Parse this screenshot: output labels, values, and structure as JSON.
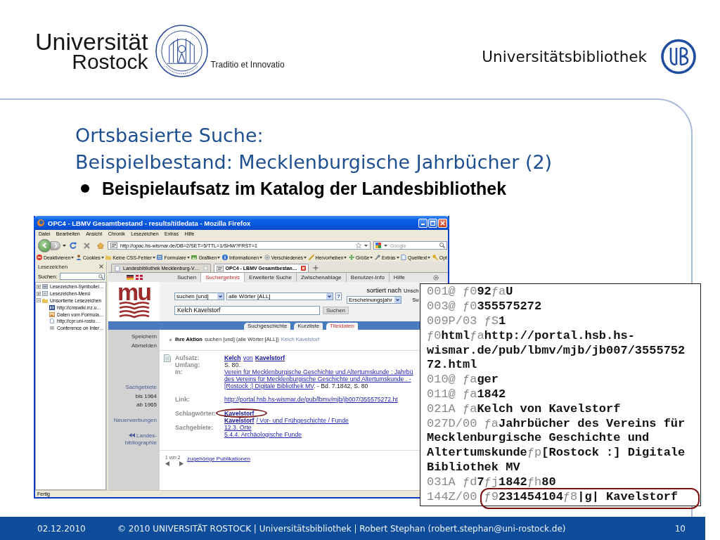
{
  "header": {
    "university": "Universität",
    "city": "Rostock",
    "motto": "Traditio et Innovatio",
    "library": "Universitätsbibliothek"
  },
  "slide": {
    "title_lines": [
      "Ortsbasierte Suche:",
      "Beispielbestand: Mecklenburgische Jahrbücher (2)"
    ],
    "bullet": "Beispielaufsatz im Katalog der Landesbibliothek"
  },
  "browser": {
    "title": "OPC4 - LBMV Gesamtbestand - results/titledata - Mozilla Firefox",
    "menu": [
      "Datei",
      "Bearbeiten",
      "Ansicht",
      "Chronik",
      "Lesezeichen",
      "Extras",
      "Hilfe"
    ],
    "address": "http://opac.hs-wismar.de/DB=2/SET=5/TTL=1/SHW?FRST=1",
    "search": {
      "placeholder": "Google"
    },
    "toolbar": [
      "Deaktivieren",
      "Cookies",
      "Keine CSS-Fehler",
      "Formulare",
      "Grafiken",
      "Informationen",
      "Verschiedenes",
      "Hervorheben",
      "Größe",
      "Extras",
      "Quelltext",
      "Opt"
    ],
    "sidebar": {
      "title": "Lesezeichen",
      "search_label": "Suchen:",
      "tree": [
        {
          "label": "Lesezeichen-Symbollei…",
          "expanded": false
        },
        {
          "label": "Lesezeichen-Menü",
          "expanded": false
        },
        {
          "label": "Unsortierte Lesezeichen",
          "expanded": true,
          "children": [
            {
              "label": "http://cmswiki.rrz.u…"
            },
            {
              "label": "Daten vom Formula…"
            },
            {
              "label": "http://cpr.uni-rosto…"
            },
            {
              "label": "Conference on Inter…"
            }
          ]
        }
      ]
    },
    "tabs": [
      {
        "label": "Landesbibliothek Mecklenburg-V…",
        "selected": false
      },
      {
        "label": "OPC4 - LBMV Gesamtbestan…",
        "selected": true
      }
    ],
    "status": "Fertig"
  },
  "opac": {
    "nav": [
      {
        "label": "Suchen",
        "selected": false
      },
      {
        "label": "Suchergebnis",
        "selected": true
      },
      {
        "label": "Erweiterte Suche",
        "selected": false
      },
      {
        "label": "Zwischenablage",
        "selected": false
      },
      {
        "label": "Benutzer-Info",
        "selected": false
      },
      {
        "label": "Hilfe",
        "selected": false
      }
    ],
    "logo_text": "mu",
    "form": {
      "mode": "suchen [und]",
      "field": "alle Wörter [ALL]",
      "help": "?",
      "sort_label": "sortiert nach",
      "sort": "Erscheinungsjahr",
      "partial_labels": [
        "Unsch",
        "Su"
      ],
      "query": "Kelch Kavelstorf",
      "submit": "Suchen"
    },
    "view_tabs": [
      {
        "label": "Suchgeschichte",
        "selected": false
      },
      {
        "label": "Kurzliste",
        "selected": false
      },
      {
        "label": "Titeldaten",
        "selected": true
      }
    ],
    "side_groups": [
      [
        {
          "label": "Speichern",
          "kind": "command"
        },
        {
          "label": "Abmelden",
          "kind": "command"
        }
      ],
      [
        {
          "label": "Sachgebiete",
          "kind": "link"
        },
        {
          "label": "bis 1964",
          "kind": "text"
        },
        {
          "label": "ab 1965",
          "kind": "text"
        }
      ],
      [
        {
          "label": "Neuerwerbungen",
          "kind": "link"
        }
      ],
      [
        {
          "label": "Landes-bibliographie",
          "kind": "back_link"
        }
      ]
    ],
    "action": {
      "label": "Ihre Aktion",
      "text": "suchen [und] (alle Wörter [ALL])",
      "query": "Kelch Kavelstorf"
    },
    "record_groups": [
      [
        {
          "label": "Aufsatz:",
          "lines": [
            [
              {
                "text": "Kelch",
                "kind": "strong_link"
              },
              {
                "text": "von",
                "kind": "link"
              },
              {
                "text": "Kavelstorf",
                "kind": "strong_link"
              }
            ]
          ]
        },
        {
          "label": "Umfang:",
          "lines": [
            [
              {
                "text": "S. 80.",
                "kind": "text"
              }
            ]
          ]
        },
        {
          "label": "In:",
          "lines": [
            [
              {
                "text": "Verein für Mecklenburgische Geschichte und Altertumskunde : Jahrbü",
                "kind": "link"
              }
            ],
            [
              {
                "text": "des Vereins für Mecklenburgische Geschichte und Altertumskunde . -",
                "kind": "link"
              }
            ],
            [
              {
                "text": "[Rostock :] Digitale Bibliothek MV",
                "kind": "link"
              },
              {
                "text": ". - Bd. 7.1842, S. 80",
                "kind": "text"
              }
            ]
          ]
        }
      ],
      [
        {
          "label": "Link:",
          "lines": [
            [
              {
                "text": "http://portal.hsb.hs-wismar.de/pub/lbmv/mjb/jb007/355575272.ht",
                "kind": "link"
              }
            ]
          ]
        }
      ],
      [
        {
          "label": "Schlagwörter:",
          "lines": [
            [
              {
                "text": "Kavelstorf",
                "kind": "strong_link"
              }
            ],
            [
              {
                "text": "Kavelstorf",
                "kind": "strong_link"
              },
              {
                "text": "/ Vor- und Frühgeschichte / Funde",
                "kind": "link"
              }
            ]
          ]
        },
        {
          "label": "Sachgebiete:",
          "lines": [
            [
              {
                "text": "12.3. Orte",
                "kind": "link"
              }
            ],
            [
              {
                "text": "5.4.4. Archäologische Funde",
                "kind": "link"
              }
            ]
          ]
        }
      ]
    ],
    "pager": {
      "count": "1 von 2",
      "link": "zugehörige Publikationen"
    }
  },
  "marc": {
    "lines": [
      {
        "kind": "coded",
        "tag": "001@",
        "text": "ƒ0**92**ƒa**U**"
      },
      {
        "kind": "coded",
        "tag": "003@",
        "text": "ƒ0**355575272**"
      },
      {
        "kind": "coded",
        "tag": "009P/03",
        "text": "ƒS**1**"
      },
      {
        "kind": "coded",
        "text": "ƒ0**html**ƒa**http://portal.hsb.hs-**"
      },
      {
        "kind": "value",
        "text": "wismar.de/pub/lbmv/mjb/jb007/3555752"
      },
      {
        "kind": "value",
        "text": "72.html"
      },
      {
        "kind": "coded",
        "tag": "010@",
        "text": "ƒa**ger**"
      },
      {
        "kind": "coded",
        "tag": "011@",
        "text": "ƒa**1842**"
      },
      {
        "kind": "coded",
        "tag": "021A",
        "text": "ƒa**Kelch von Kavelstorf**"
      },
      {
        "kind": "coded",
        "tag": "027D/00",
        "text": "ƒa**Jahrbücher des Vereins für**"
      },
      {
        "kind": "value",
        "text": "Mecklenburgische Geschichte und"
      },
      {
        "kind": "coded",
        "text": "**Altertumskunde**ƒp**[Rostock :] Digitale**"
      },
      {
        "kind": "value",
        "text": "Bibliothek MV"
      },
      {
        "kind": "coded",
        "tag": "031A",
        "text": "ƒd**7**ƒj**1842**ƒh**80**"
      },
      {
        "kind": "coded",
        "tag": "144Z/00",
        "text": "ƒ9**231454104**ƒ8**|g| Kavelstorf**"
      }
    ]
  },
  "footer": {
    "date": "02.12.2010",
    "text": "© 2010 UNIVERSITÄT ROSTOCK | Universitätsbibliothek | Robert Stephan (robert.stephan@uni-rostock.de)",
    "page": "10"
  }
}
